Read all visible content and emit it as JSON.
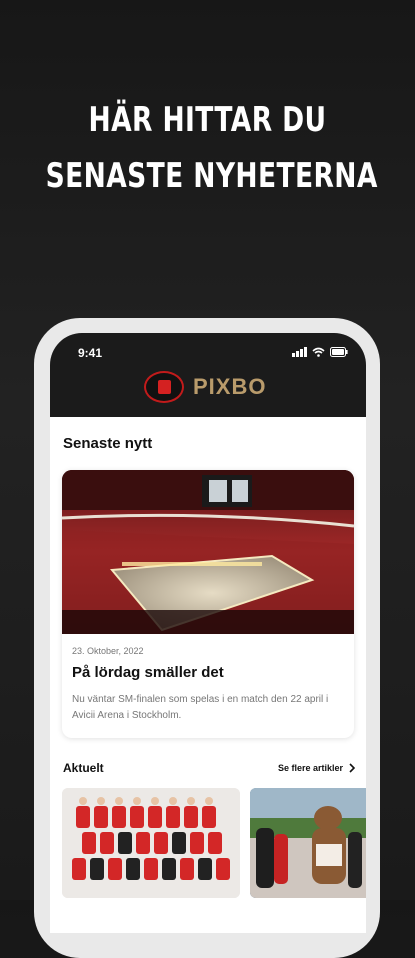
{
  "headline": {
    "line1": "HÄR HITTAR DU",
    "line2": "SENASTE NYHETERNA"
  },
  "status_bar": {
    "time": "9:41",
    "icons": [
      "signal-icon",
      "wifi-icon",
      "battery-icon"
    ]
  },
  "app": {
    "brand": "PIXBO",
    "colors": {
      "header_bg": "#1b1b1b",
      "brand_gold": "#b99b6b",
      "badge_red": "#c21b1b"
    }
  },
  "latest": {
    "section_title": "Senaste nytt",
    "featured": {
      "date": "23. Oktober, 2022",
      "title": "På lördag smäller det",
      "description": "Nu väntar SM-finalen som spelas i en match den 22 april i Avicii Arena i Stockholm."
    }
  },
  "current": {
    "section_title": "Aktuelt",
    "more_link": "Se flere artikler"
  }
}
